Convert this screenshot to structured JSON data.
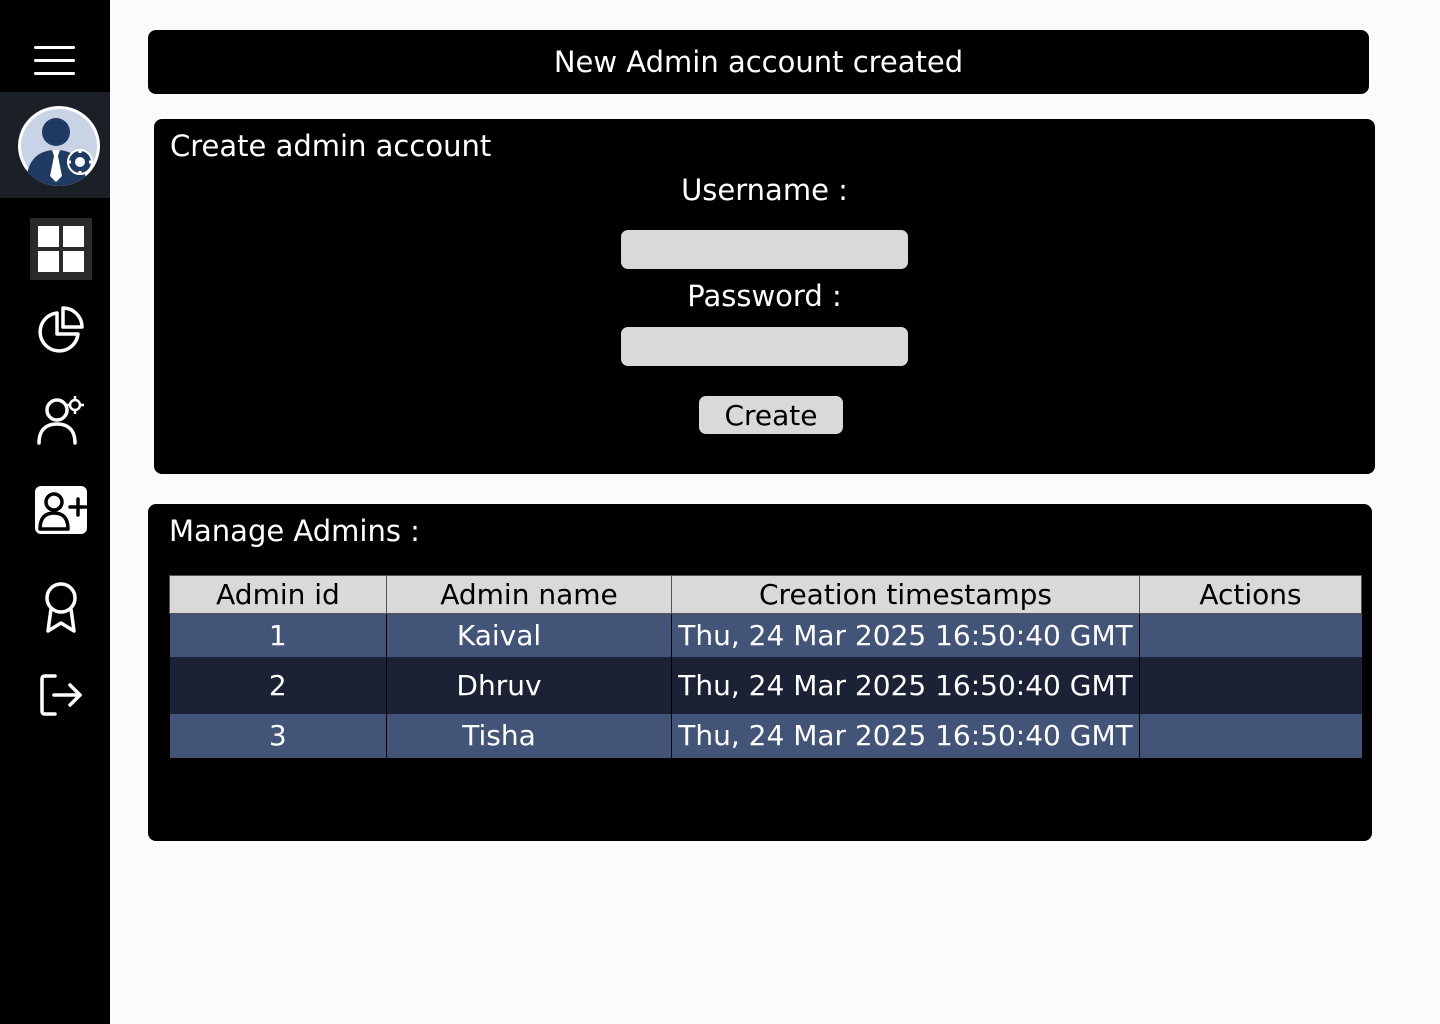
{
  "banner": {
    "message": "New Admin account created"
  },
  "sidebar": {
    "menu_icon": "hamburger-menu-icon",
    "avatar_icon": "admin-avatar-gear-icon",
    "items": [
      {
        "icon": "dashboard-grid-icon",
        "active": true
      },
      {
        "icon": "pie-chart-icon",
        "active": false
      },
      {
        "icon": "user-settings-icon",
        "active": false
      },
      {
        "icon": "add-user-icon",
        "active": false
      },
      {
        "icon": "award-ribbon-icon",
        "active": false
      },
      {
        "icon": "logout-icon",
        "active": false
      }
    ]
  },
  "create_form": {
    "title": "Create admin account",
    "username_label": "Username :",
    "username_value": "",
    "password_label": "Password :",
    "password_value": "",
    "submit_label": "Create"
  },
  "manage": {
    "title": "Manage Admins :",
    "columns": [
      "Admin  id",
      "Admin name",
      "Creation timestamps",
      "Actions"
    ],
    "rows": [
      {
        "id": "1",
        "name": "Kaival",
        "created": "Thu, 24 Mar 2025 16:50:40 GMT",
        "actions": ""
      },
      {
        "id": "2",
        "name": "Dhruv",
        "created": "Thu, 24 Mar 2025 16:50:40 GMT",
        "actions": ""
      },
      {
        "id": "3",
        "name": "Tisha",
        "created": "Thu, 24 Mar 2025 16:50:40 GMT",
        "actions": ""
      }
    ]
  },
  "colors": {
    "sidebar": "#000000",
    "row_light": "#435479",
    "row_dark": "#1b2236",
    "header_bg": "#d9d9d9"
  }
}
